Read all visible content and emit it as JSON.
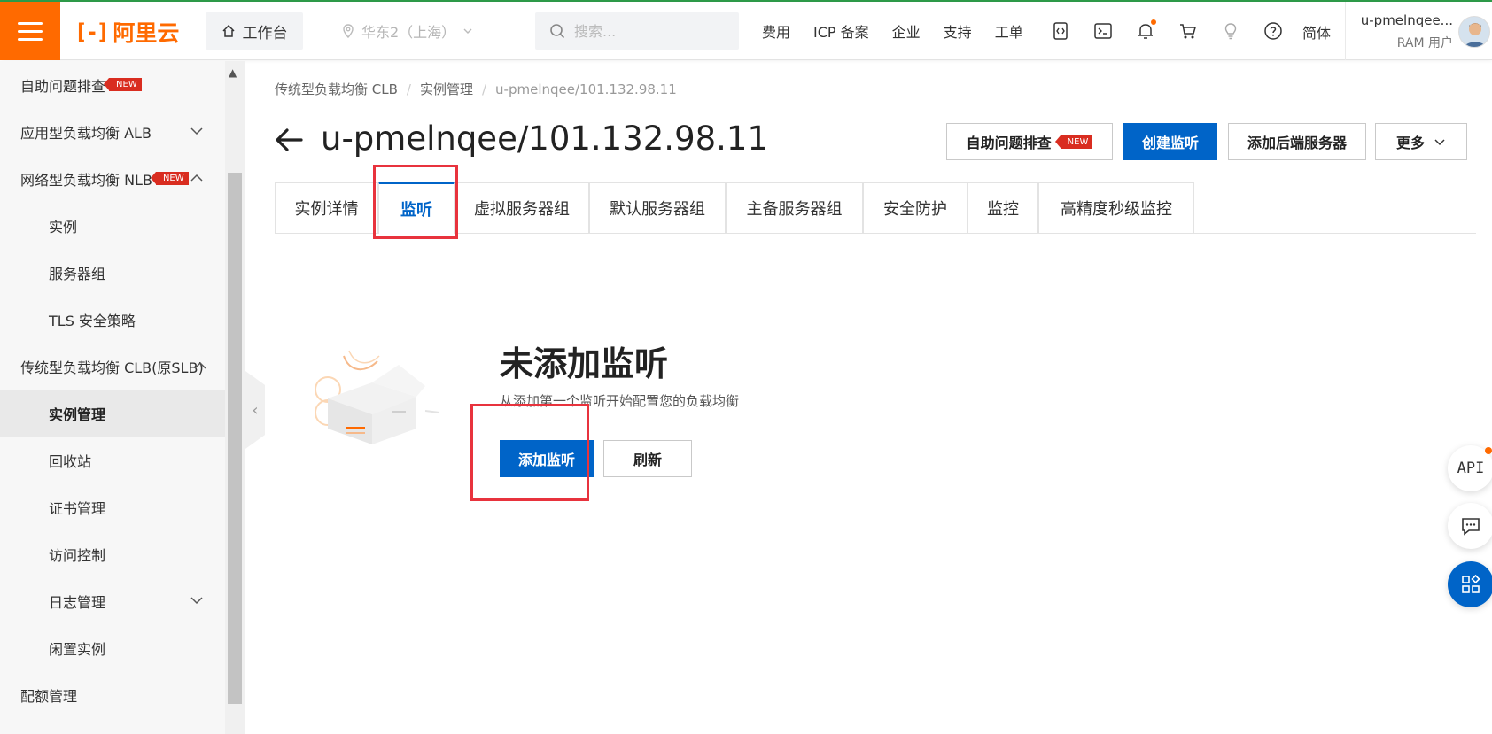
{
  "header": {
    "logo_text": "阿里云",
    "workbench": "工作台",
    "region": "华东2（上海）",
    "search_placeholder": "搜索...",
    "links": [
      "费用",
      "ICP 备案",
      "企业",
      "支持",
      "工单"
    ],
    "icons": [
      "code-icon",
      "terminal-icon",
      "bell-icon",
      "cart-icon",
      "bulb-icon",
      "help-icon"
    ],
    "lang": "简体",
    "user_name": "u-pmelnqee...",
    "user_role": "RAM 用户"
  },
  "sidebar": {
    "items": [
      {
        "label": "自助问题排查",
        "badge": "NEW",
        "level": 1
      },
      {
        "label": "应用型负载均衡 ALB",
        "level": 1,
        "chevron": "down"
      },
      {
        "label": "网络型负载均衡 NLB",
        "badge": "NEW",
        "level": 1,
        "chevron": "up"
      },
      {
        "label": "实例",
        "level": 2
      },
      {
        "label": "服务器组",
        "level": 2
      },
      {
        "label": "TLS 安全策略",
        "level": 2
      },
      {
        "label": "传统型负载均衡 CLB(原SLB)",
        "level": 1,
        "chevron": "up"
      },
      {
        "label": "实例管理",
        "level": 2,
        "active": true
      },
      {
        "label": "回收站",
        "level": 2
      },
      {
        "label": "证书管理",
        "level": 2
      },
      {
        "label": "访问控制",
        "level": 2
      },
      {
        "label": "日志管理",
        "level": 2,
        "chevron": "down"
      },
      {
        "label": "闲置实例",
        "level": 2
      },
      {
        "label": "配额管理",
        "level": 1
      }
    ]
  },
  "breadcrumb": [
    "传统型负载均衡 CLB",
    "实例管理",
    "u-pmelnqee/101.132.98.11"
  ],
  "page_title": "u-pmelnqee/101.132.98.11",
  "actions": {
    "troubleshoot": "自助问题排查",
    "troubleshoot_badge": "NEW",
    "create_listener": "创建监听",
    "add_backend": "添加后端服务器",
    "more": "更多"
  },
  "tabs": [
    "实例详情",
    "监听",
    "虚拟服务器组",
    "默认服务器组",
    "主备服务器组",
    "安全防护",
    "监控",
    "高精度秒级监控"
  ],
  "active_tab": "监听",
  "empty_state": {
    "title": "未添加监听",
    "desc": "从添加第一个监听开始配置您的负载均衡",
    "add_button": "添加监听",
    "refresh_button": "刷新"
  },
  "float": {
    "api_label": "API"
  },
  "colors": {
    "brand_orange": "#ff6a00",
    "primary_blue": "#0064c8",
    "highlight_red": "#e8333d",
    "new_badge_red": "#d92d20"
  }
}
